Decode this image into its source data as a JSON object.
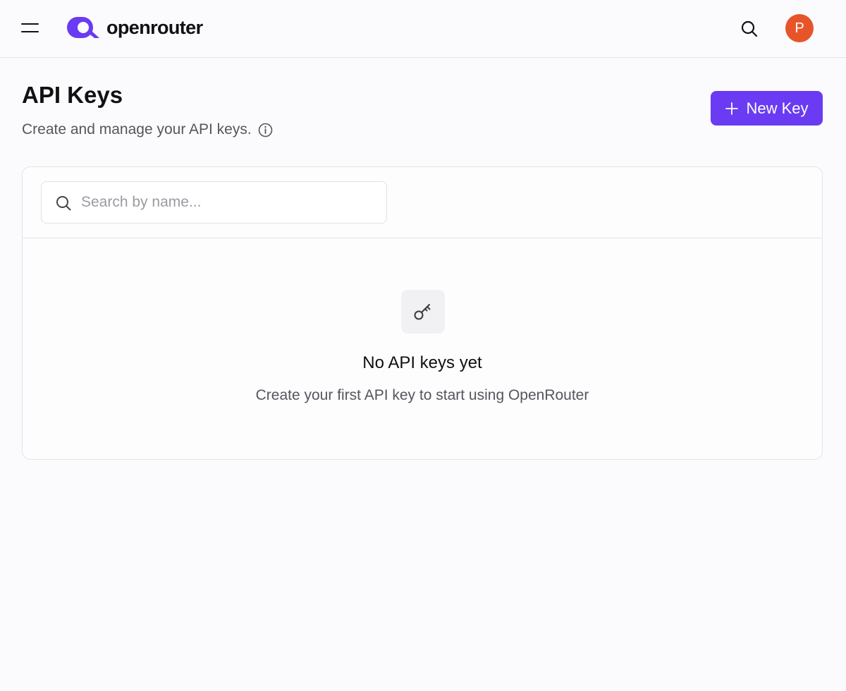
{
  "header": {
    "brand": "openrouter",
    "avatar_initial": "P",
    "icons": {
      "menu": "hamburger-menu-icon",
      "search": "search-icon",
      "logo": "openrouter-logo-icon"
    },
    "colors": {
      "logo": "#6a3bf2",
      "avatar": "#e8542a"
    }
  },
  "page": {
    "title": "API Keys",
    "subtitle": "Create and manage your API keys.",
    "subtitle_icon": "info-icon",
    "new_key_label": "New Key",
    "new_key_icon": "plus-icon",
    "accent": "#6a3bf2"
  },
  "search": {
    "placeholder": "Search by name...",
    "value": "",
    "icon": "search-icon"
  },
  "empty_state": {
    "icon": "key-icon",
    "title": "No API keys yet",
    "message": "Create your first API key to start using OpenRouter"
  }
}
